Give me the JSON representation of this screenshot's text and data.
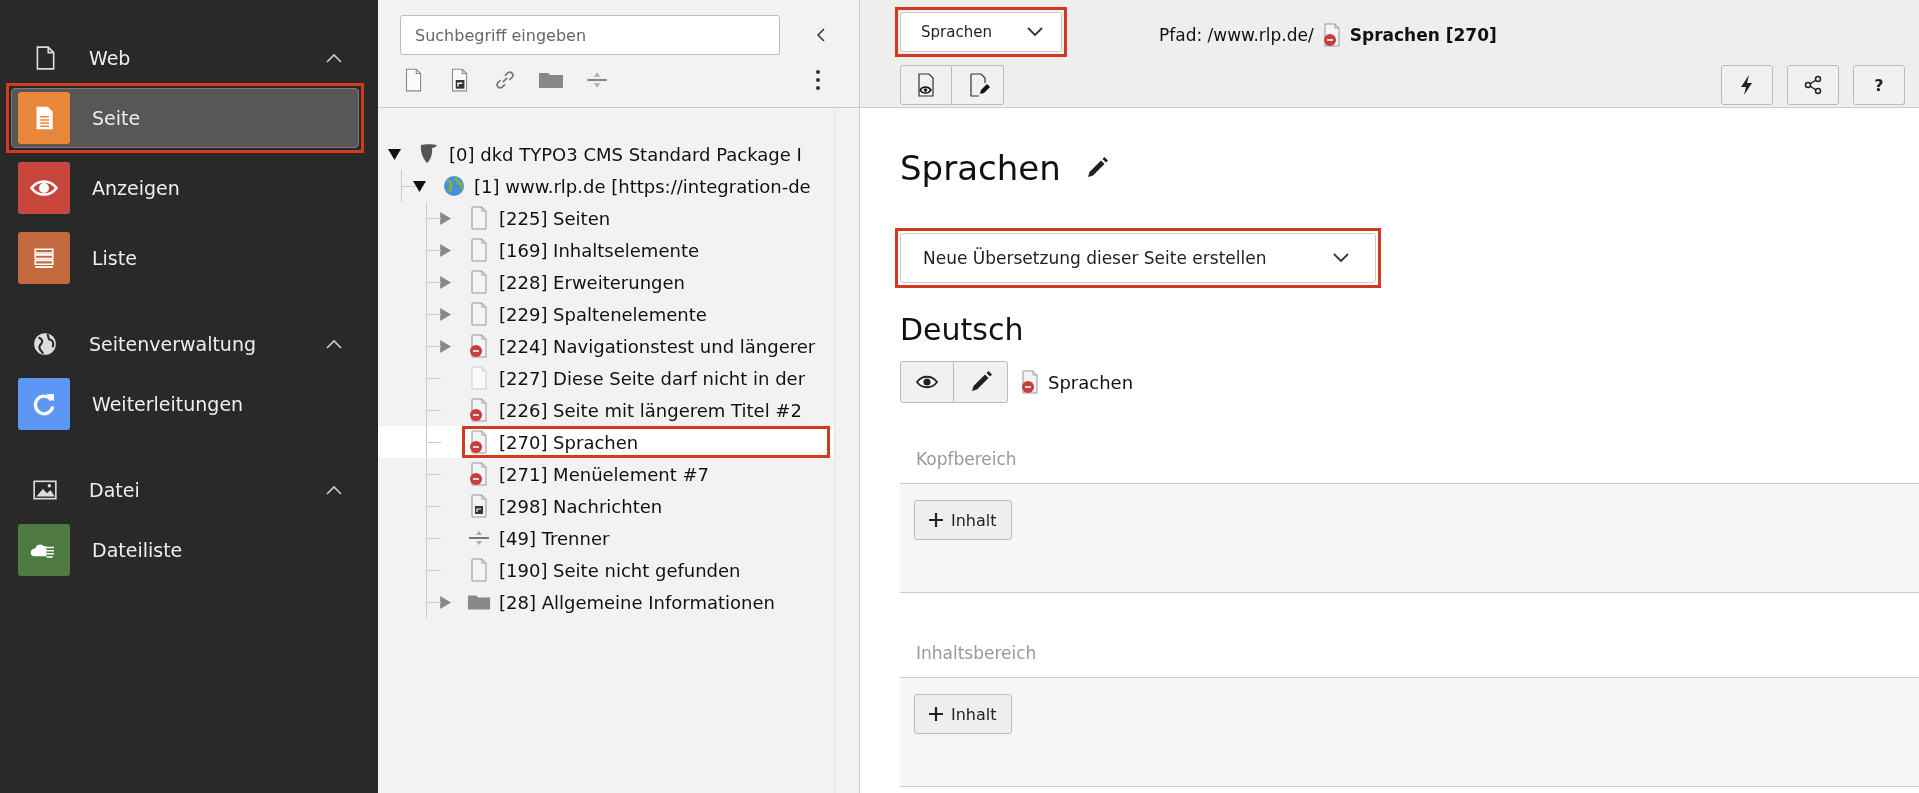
{
  "sidebar": {
    "groups": [
      {
        "label": "Web",
        "kind": "page",
        "expanded": true,
        "items": [
          {
            "label": "Seite",
            "kind": "page",
            "selected": true,
            "highlighted": true
          },
          {
            "label": "Anzeigen",
            "kind": "eye",
            "selected": false,
            "highlighted": false
          },
          {
            "label": "Liste",
            "kind": "list",
            "selected": false,
            "highlighted": false
          }
        ]
      },
      {
        "label": "Seitenverwaltung",
        "kind": "globe",
        "expanded": true,
        "items": [
          {
            "label": "Weiterleitungen",
            "kind": "redirect",
            "selected": false,
            "highlighted": false
          }
        ]
      },
      {
        "label": "Datei",
        "kind": "image",
        "expanded": true,
        "items": [
          {
            "label": "Dateiliste",
            "kind": "filelist",
            "selected": false,
            "highlighted": false
          }
        ]
      }
    ]
  },
  "tree": {
    "search": {
      "placeholder": "Suchbegriff eingeben"
    },
    "nodes": [
      {
        "label": "[0] dkd TYPO3 CMS Standard Package I",
        "kind": "root",
        "expanded": true,
        "selected": false,
        "highlighted": false,
        "children": [
          {
            "label": "[1] www.rlp.de [https://integration-de",
            "kind": "site",
            "expanded": true,
            "selected": false,
            "highlighted": false,
            "children": [
              {
                "label": "[225] Seiten",
                "kind": "page",
                "hidden": false,
                "expanded": false,
                "selected": false,
                "highlighted": false
              },
              {
                "label": "[169] Inhaltselemente",
                "kind": "page",
                "hidden": false,
                "expanded": false,
                "selected": false,
                "highlighted": false
              },
              {
                "label": "[228] Erweiterungen",
                "kind": "page",
                "hidden": false,
                "expanded": false,
                "selected": false,
                "highlighted": false
              },
              {
                "label": "[229] Spaltenelemente",
                "kind": "page",
                "hidden": false,
                "expanded": false,
                "selected": false,
                "highlighted": false
              },
              {
                "label": "[224] Navigationstest und längerer",
                "kind": "page",
                "hidden": true,
                "expanded": false,
                "selected": false,
                "highlighted": false
              },
              {
                "label": "[227] Diese Seite darf nicht in der",
                "kind": "page-faded",
                "hidden": false,
                "selected": false,
                "highlighted": false
              },
              {
                "label": "[226] Seite mit längerem Titel #2",
                "kind": "page",
                "hidden": true,
                "selected": false,
                "highlighted": false
              },
              {
                "label": "[270] Sprachen",
                "kind": "page",
                "hidden": true,
                "selected": true,
                "highlighted": true
              },
              {
                "label": "[271] Menüelement #7",
                "kind": "page",
                "hidden": true,
                "selected": false,
                "highlighted": false
              },
              {
                "label": "[298] Nachrichten",
                "kind": "shortcut",
                "selected": false,
                "highlighted": false
              },
              {
                "label": "[49] Trenner",
                "kind": "separator",
                "selected": false,
                "highlighted": false
              },
              {
                "label": "[190] Seite nicht gefunden",
                "kind": "page",
                "hidden": false,
                "selected": false,
                "highlighted": false
              },
              {
                "label": "[28] Allgemeine Informationen",
                "kind": "folder",
                "expanded": false,
                "selected": false,
                "highlighted": false
              }
            ]
          }
        ]
      }
    ]
  },
  "header": {
    "language_select": {
      "value": "Sprachen",
      "highlighted": true
    },
    "path": {
      "prefix": "Pfad: /www.rlp.de/",
      "page": "Sprachen [270]",
      "hidden": true
    },
    "help": "?"
  },
  "content": {
    "title": "Sprachen",
    "translation_select": {
      "value": "Neue Übersetzung dieser Seite erstellen",
      "highlighted": true
    },
    "language": "Deutsch",
    "page": {
      "label": "Sprachen",
      "hidden": true
    },
    "sections": [
      {
        "title": "Kopfbereich",
        "button": "Inhalt"
      },
      {
        "title": "Inhaltsbereich",
        "button": "Inhalt"
      }
    ]
  }
}
